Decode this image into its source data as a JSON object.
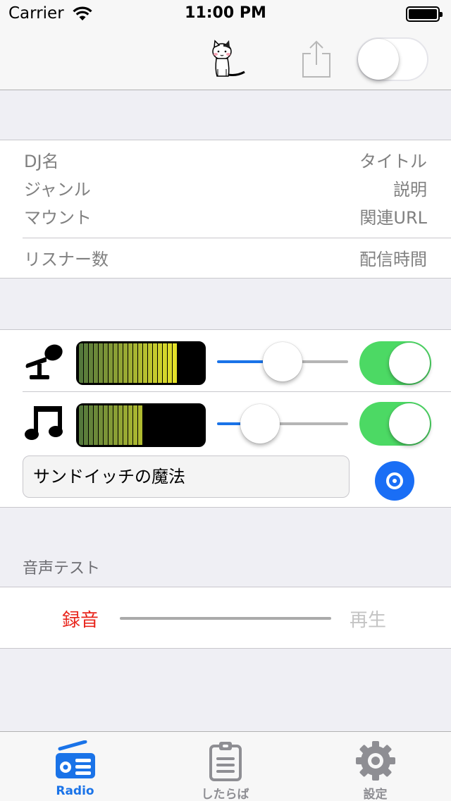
{
  "status_bar": {
    "carrier": "Carrier",
    "time": "11:00 PM"
  },
  "nav": {
    "logo_icon": "cat-icon",
    "share_icon": "share-icon",
    "broadcast_toggle_on": false
  },
  "info": {
    "left": [
      "DJ名",
      "ジャンル",
      "マウント"
    ],
    "right": [
      "タイトル",
      "説明",
      "関連URL"
    ],
    "listeners_label": "リスナー数",
    "duration_label": "配信時間"
  },
  "audio": {
    "mic": {
      "icon": "microphone-icon",
      "level_bars": 20,
      "volume": 0.5,
      "enabled": true
    },
    "music": {
      "icon": "music-note-icon",
      "level_bars": 13,
      "volume": 0.25,
      "enabled": true
    },
    "song_title": "サンドイッチの魔法",
    "target_icon": "target-icon"
  },
  "voice_test": {
    "header": "音声テスト",
    "record_label": "録音",
    "play_label": "再生",
    "progress": 0
  },
  "tabs": [
    {
      "label": "Radio",
      "icon": "radio-icon",
      "selected": true
    },
    {
      "label": "したらば",
      "icon": "clipboard-icon",
      "selected": false
    },
    {
      "label": "設定",
      "icon": "gear-icon",
      "selected": false
    }
  ],
  "colors": {
    "accent": "#1a73e8",
    "toggle_on": "#4cd964",
    "record": "#e8251c",
    "tab_inactive": "#8e8e93"
  }
}
